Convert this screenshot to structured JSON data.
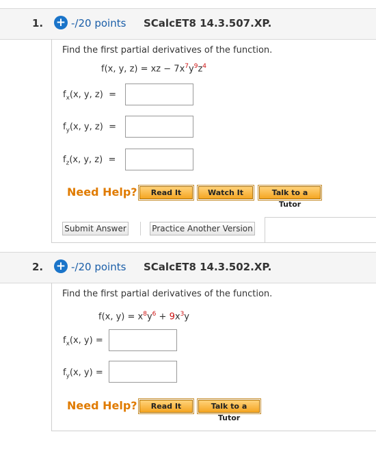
{
  "q1": {
    "number": "1.",
    "plus": "+",
    "points": "-/20 points",
    "code": "SCalcET8 14.3.507.XP.",
    "prompt": "Find the first partial derivatives of the function.",
    "func_prefix": "f(x, y, z) = xz − 7x",
    "exp_x": "7",
    "y": "y",
    "exp_y": "9",
    "z": "z",
    "exp_z": "4",
    "fx": {
      "f": "f",
      "sub": "x",
      "args": "(x, y, z)",
      "eq": "="
    },
    "fy": {
      "f": "f",
      "sub": "y",
      "args": "(x, y, z)",
      "eq": "="
    },
    "fz": {
      "f": "f",
      "sub": "z",
      "args": "(x, y, z)",
      "eq": "="
    },
    "need_help": "Need Help?",
    "read_it": "Read It",
    "watch_it": "Watch It",
    "talk_tutor": "Talk to a Tutor",
    "submit": "Submit Answer",
    "practice": "Practice Another Version"
  },
  "q2": {
    "number": "2.",
    "plus": "+",
    "points": "-/20 points",
    "code": "SCalcET8 14.3.502.XP.",
    "prompt": "Find the first partial derivatives of the function.",
    "func_prefix": "f(x, y) = x",
    "exp_x1": "8",
    "y": "y",
    "exp_y": "6",
    "plus_term": " + ",
    "coef": "9",
    "x2": "x",
    "exp_x2": "3",
    "y2": "y",
    "fx": {
      "f": "f",
      "sub": "x",
      "args": "(x, y)",
      "eq": "="
    },
    "fy": {
      "f": "f",
      "sub": "y",
      "args": "(x, y)",
      "eq": "="
    },
    "need_help": "Need Help?",
    "read_it": "Read It",
    "talk_tutor": "Talk to a Tutor"
  },
  "colors": {
    "accent": "#1a74c9",
    "help": "#e07b00",
    "red": "#cc1111"
  }
}
